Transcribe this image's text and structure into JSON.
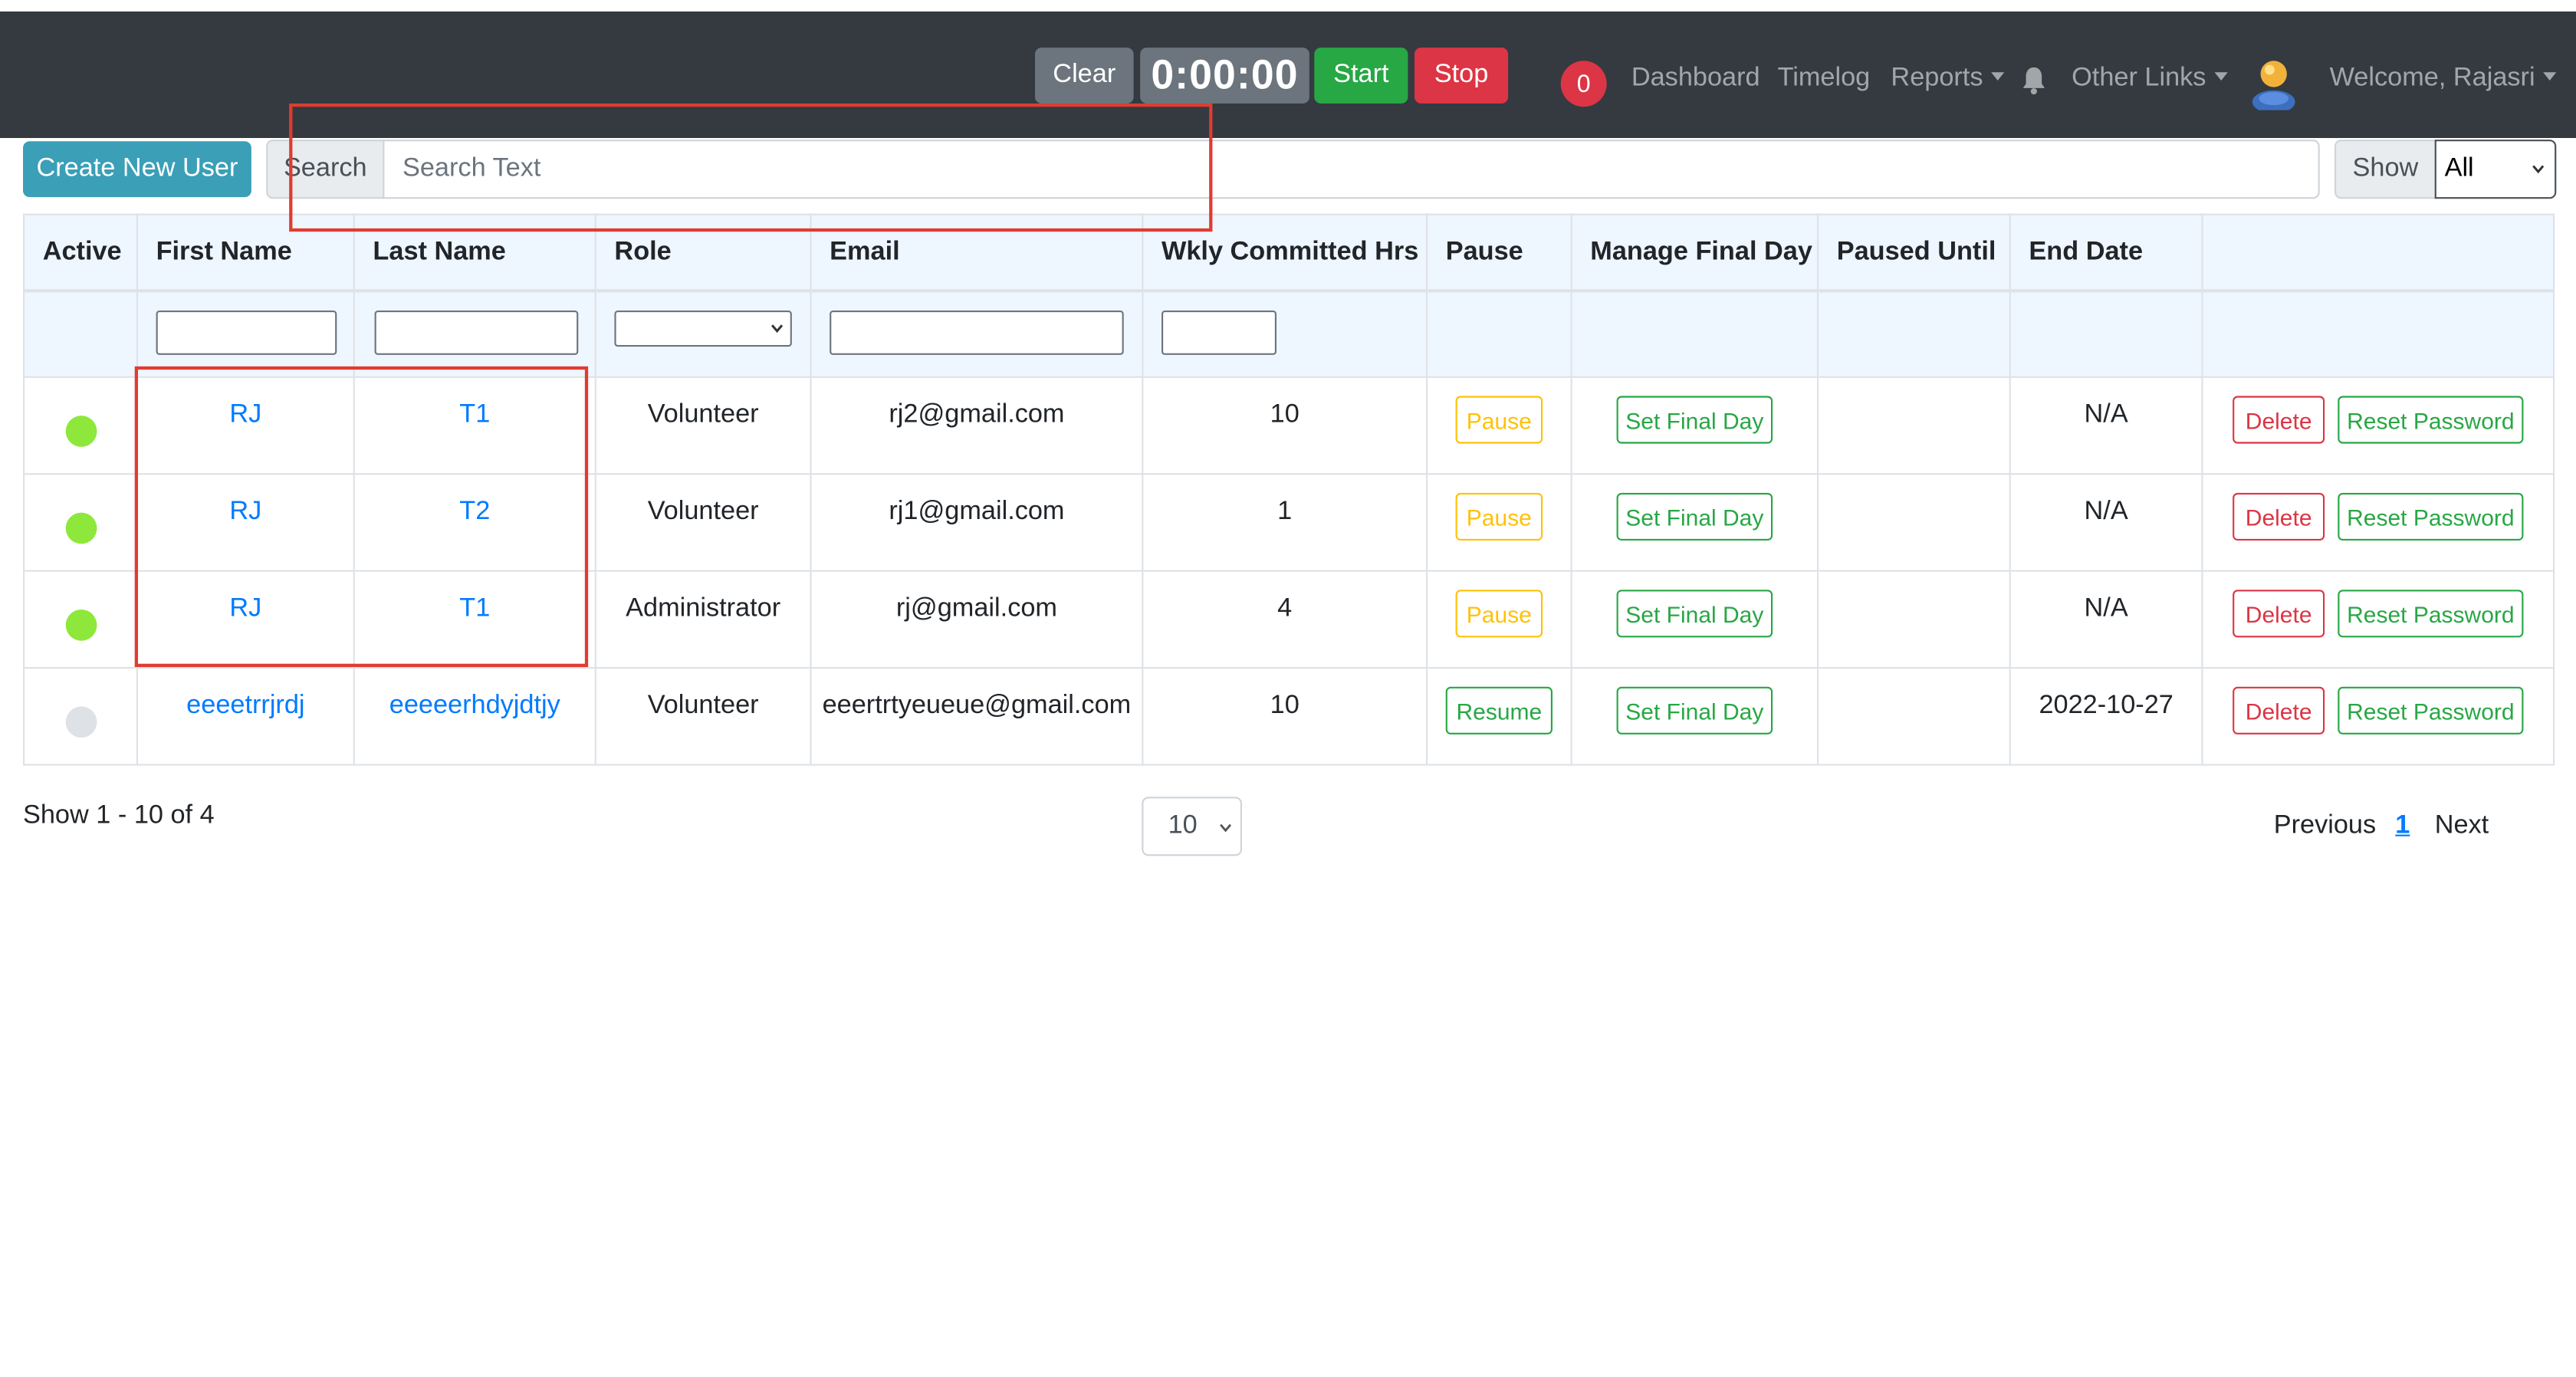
{
  "navbar": {
    "clear_label": "Clear",
    "timer": "0:00:00",
    "start_label": "Start",
    "stop_label": "Stop",
    "notification_count": "0",
    "links": [
      "Dashboard",
      "Timelog",
      "Reports",
      "Other Links"
    ],
    "welcome": "Welcome, Rajasri",
    "bell_icon": "bell-icon",
    "avatar_icon": "user-avatar-icon"
  },
  "toolbar": {
    "create_label": "Create New User",
    "search_label": "Search",
    "search_placeholder": "Search Text",
    "show_label": "Show",
    "show_value": "All"
  },
  "table": {
    "headers": [
      "Active",
      "First Name",
      "Last Name",
      "Role",
      "Email",
      "Wkly Committed Hrs",
      "Pause",
      "Manage Final Day",
      "Paused Until",
      "End Date",
      ""
    ],
    "rows": [
      {
        "active": true,
        "first": "RJ",
        "last": "T1",
        "role": "Volunteer",
        "email": "rj2@gmail.com",
        "hours": "10",
        "pause": "Pause",
        "final": "Set Final Day",
        "paused_until": "",
        "end_date": "N/A",
        "delete": "Delete",
        "reset": "Reset Password"
      },
      {
        "active": true,
        "first": "RJ",
        "last": "T2",
        "role": "Volunteer",
        "email": "rj1@gmail.com",
        "hours": "1",
        "pause": "Pause",
        "final": "Set Final Day",
        "paused_until": "",
        "end_date": "N/A",
        "delete": "Delete",
        "reset": "Reset Password"
      },
      {
        "active": true,
        "first": "RJ",
        "last": "T1",
        "role": "Administrator",
        "email": "rj@gmail.com",
        "hours": "4",
        "pause": "Pause",
        "final": "Set Final Day",
        "paused_until": "",
        "end_date": "N/A",
        "delete": "Delete",
        "reset": "Reset Password"
      },
      {
        "active": false,
        "first": "eeeetrrjrdj",
        "last": "eeeeerhdyjdtjy",
        "role": "Volunteer",
        "email": "eeertrtyeueue@gmail.com",
        "hours": "10",
        "pause": "Resume",
        "final": "Set Final Day",
        "paused_until": "",
        "end_date": "2022-10-27",
        "delete": "Delete",
        "reset": "Reset Password"
      }
    ]
  },
  "footer": {
    "show_count": "Show 1 - 10 of 4",
    "page_size": "10",
    "previous": "Previous",
    "current_page": "1",
    "next": "Next"
  },
  "colors": {
    "navbar": "#343a40",
    "active_dot": "#8ee83b",
    "inactive_dot": "#dee2e6",
    "annotation": "#e03c31"
  }
}
